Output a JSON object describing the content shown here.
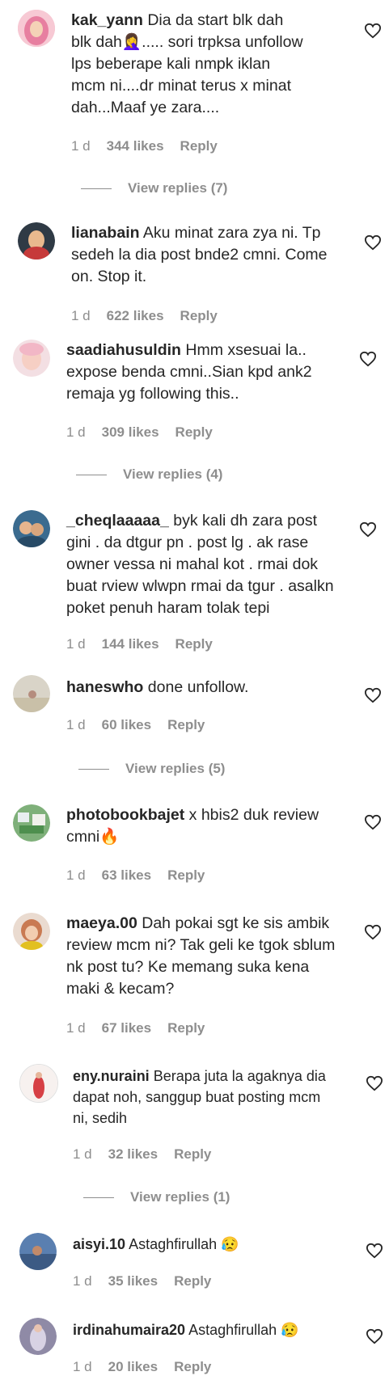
{
  "comments": [
    {
      "username": "kak_yann",
      "text": "Dia da start blk dah blk dah🤦‍♀️..... sori trpksa unfollow lps beberape kali nmpk iklan mcm ni....dr minat terus x minat dah...Maaf ye zara....",
      "time": "1 d",
      "likes": "344 likes",
      "reply": "Reply"
    },
    {
      "username": "lianabain",
      "text": "Aku minat zara zya ni. Tp sedeh la dia post bnde2 cmni. Come on. Stop it.",
      "time": "1 d",
      "likes": "622 likes",
      "reply": "Reply"
    },
    {
      "username": "saadiahusuldin",
      "text": "Hmm xsesuai la.. expose benda cmni..Sian kpd ank2 remaja yg following this..",
      "time": "1 d",
      "likes": "309 likes",
      "reply": "Reply"
    },
    {
      "username": "_cheqlaaaaa_",
      "text": "byk kali dh zara post gini . da dtgur pn . post lg . ak rase owner vessa ni mahal kot . rmai dok buat rview wlwpn rmai da tgur . asalkn poket penuh haram tolak tepi",
      "time": "1 d",
      "likes": "144 likes",
      "reply": "Reply"
    },
    {
      "username": "haneswho",
      "text": "done unfollow.",
      "time": "1 d",
      "likes": "60 likes",
      "reply": "Reply"
    },
    {
      "username": "photobookbajet",
      "text": "x hbis2 duk review cmni🔥",
      "time": "1 d",
      "likes": "63 likes",
      "reply": "Reply"
    },
    {
      "username": "maeya.00",
      "text": "Dah pokai sgt ke sis ambik review mcm ni? Tak geli ke tgok sblum nk post tu? Ke memang suka kena maki & kecam?",
      "time": "1 d",
      "likes": "67 likes",
      "reply": "Reply"
    },
    {
      "username": "eny.nuraini",
      "text": "Berapa juta la agaknya dia dapat noh, sanggup buat posting mcm ni, sedih",
      "time": "1 d",
      "likes": "32 likes",
      "reply": "Reply"
    },
    {
      "username": "aisyi.10",
      "text": "Astaghfirullah 😥",
      "time": "1 d",
      "likes": "35 likes",
      "reply": "Reply"
    },
    {
      "username": "irdinahumaira20",
      "text": "Astaghfirullah 😥",
      "time": "1 d",
      "likes": "20 likes",
      "reply": "Reply"
    }
  ],
  "view_replies": [
    "View replies (7)",
    "View replies (4)",
    "View replies (5)",
    "View replies (1)"
  ],
  "colors": {
    "text": "#262626",
    "secondary": "#8e8e8e",
    "background": "#ffffff"
  }
}
